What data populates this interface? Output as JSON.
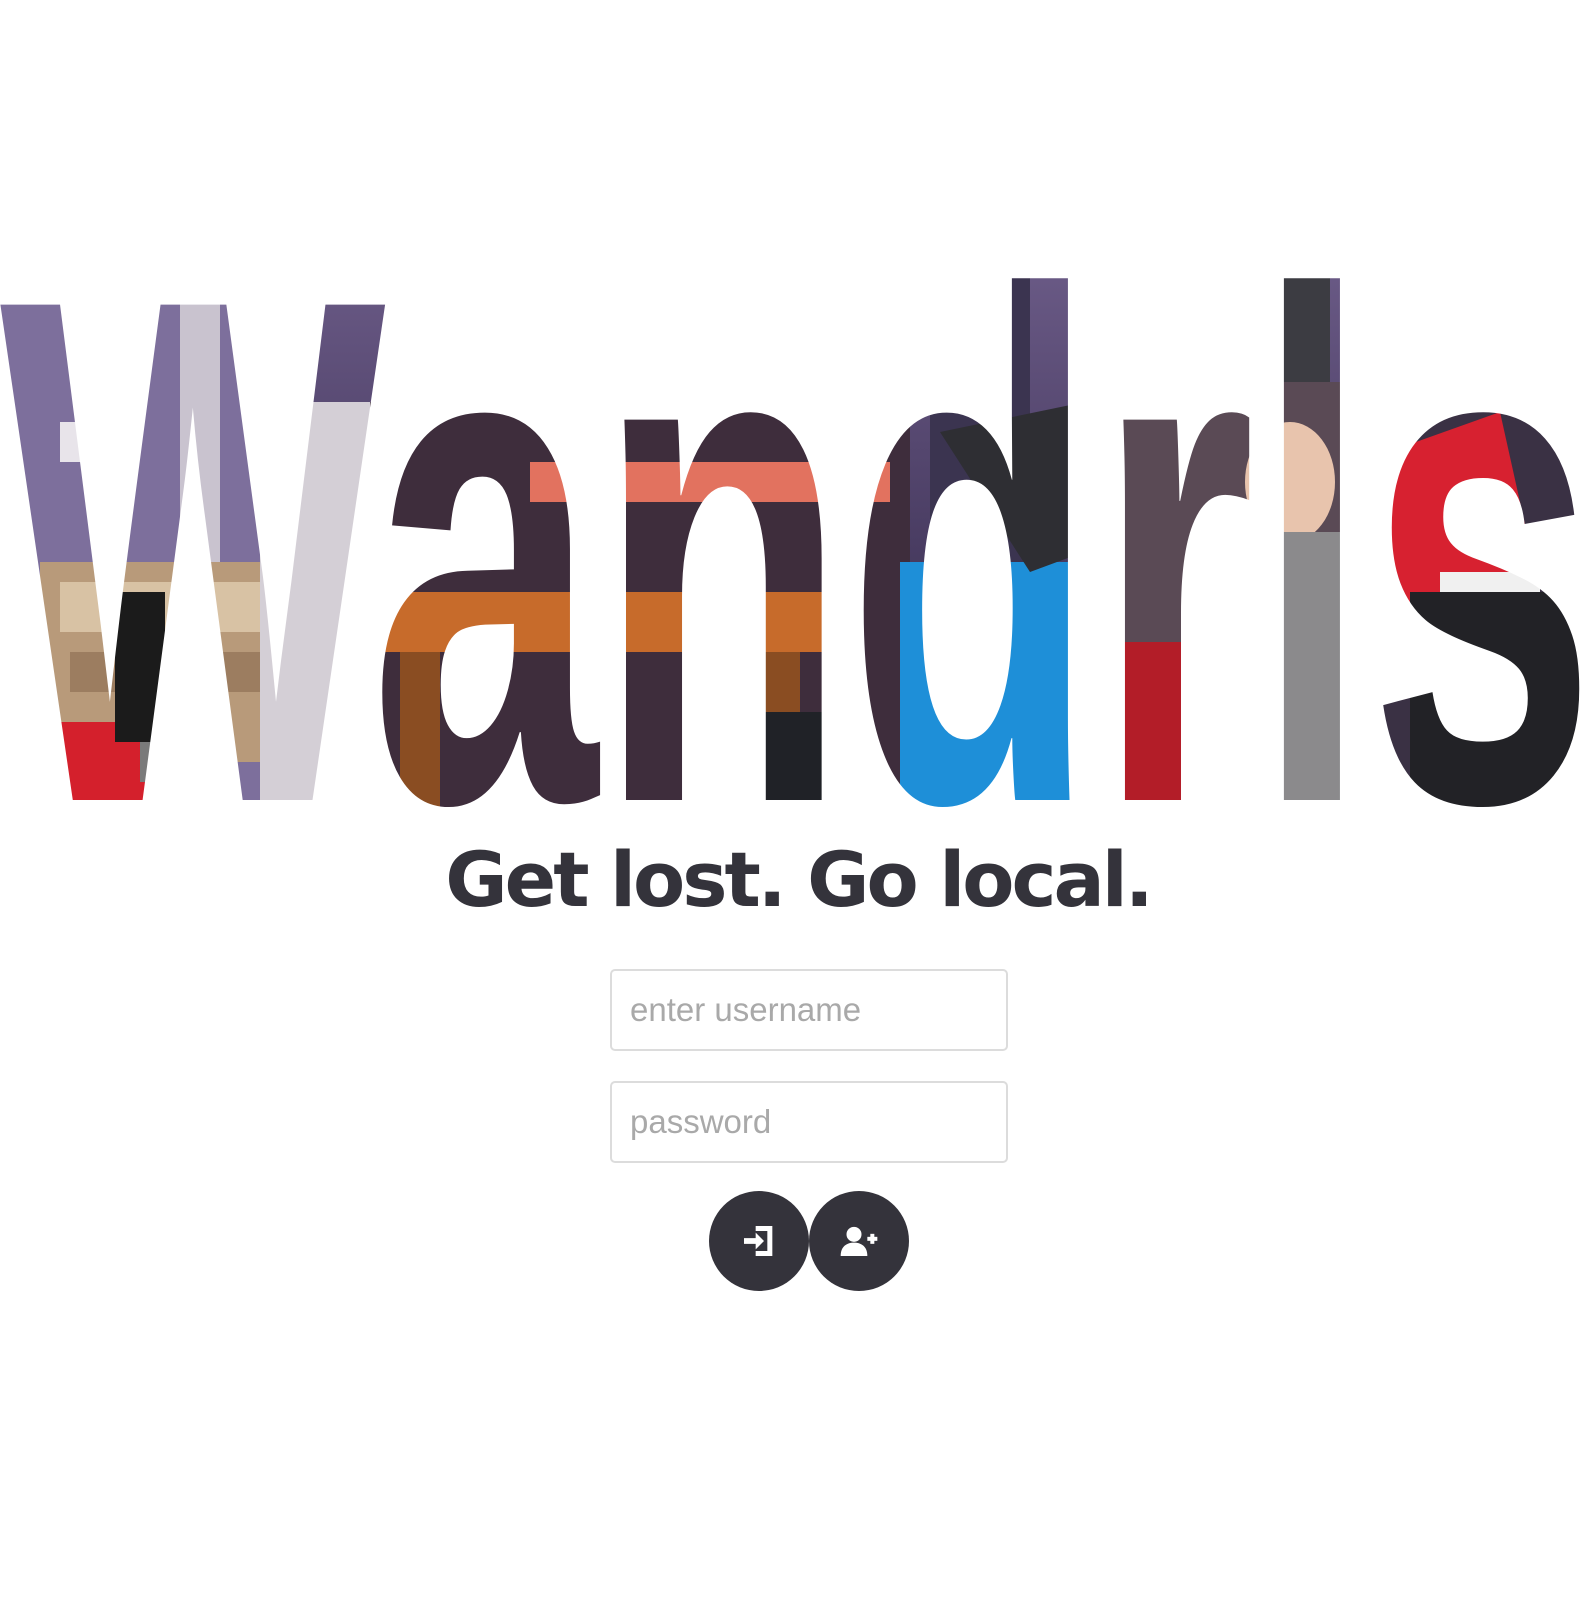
{
  "brand": {
    "name": "Wandrls",
    "tagline": "Get lost. Go local."
  },
  "login_form": {
    "username_placeholder": "enter username",
    "password_placeholder": "password"
  },
  "actions": {
    "login_icon": "sign-in-icon",
    "signup_icon": "user-add-icon"
  },
  "colors": {
    "text": "#34333b",
    "button_bg": "#34333b",
    "button_icon": "#ffffff",
    "field_border": "#dcdcdc",
    "placeholder": "#a9a9a9"
  }
}
